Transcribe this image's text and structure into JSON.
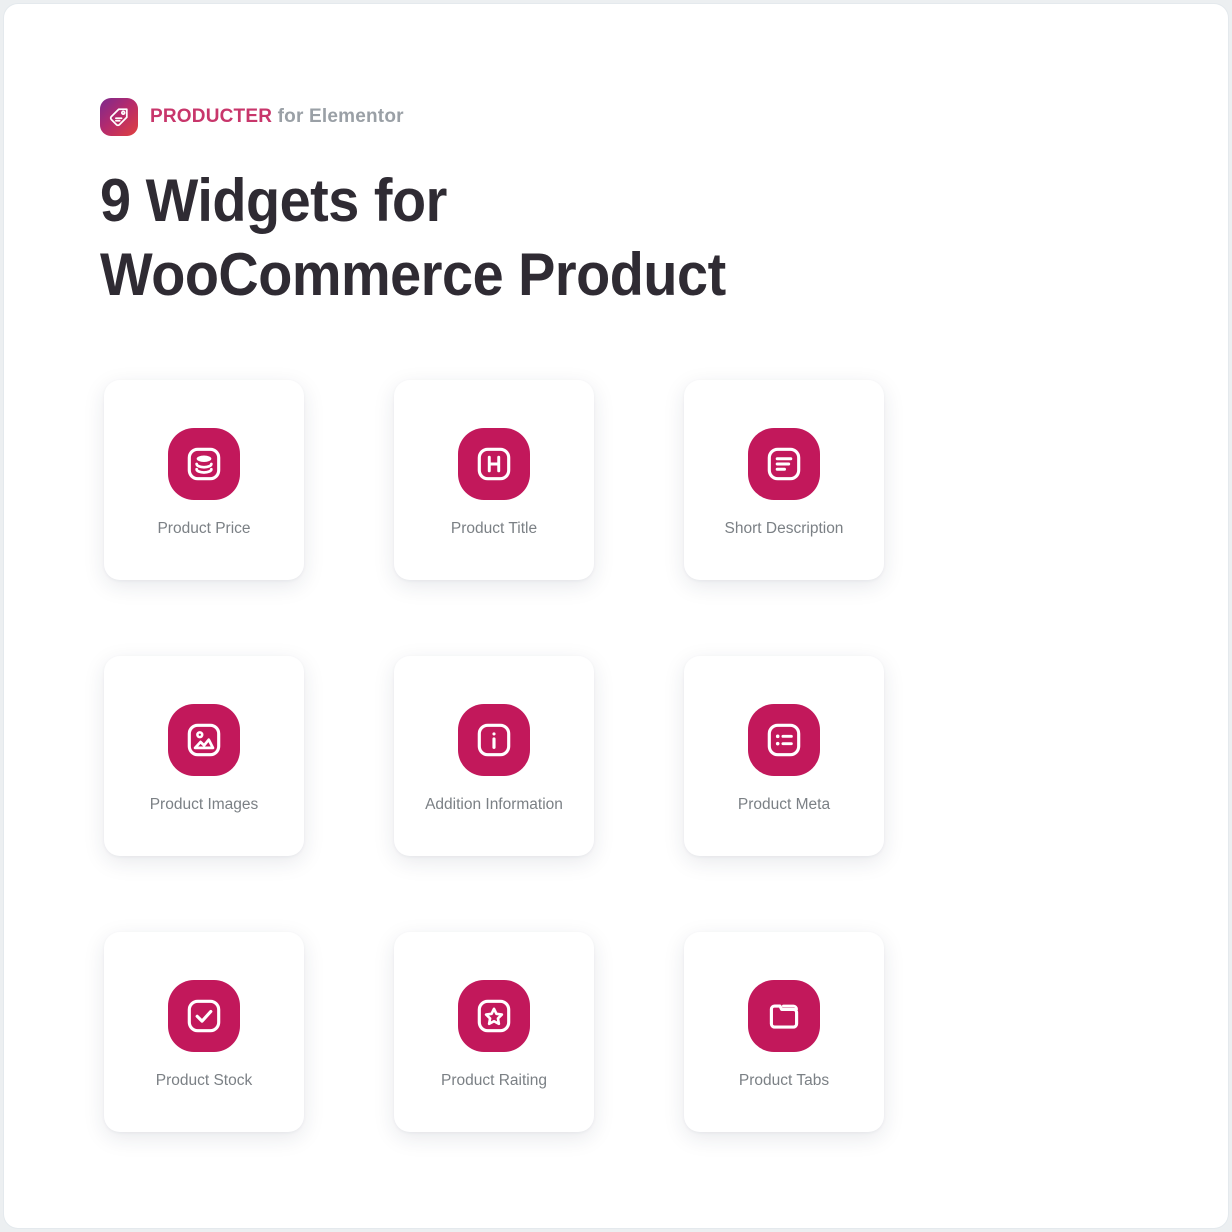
{
  "brand": {
    "logo_icon": "price-tag-icon",
    "name": "PRODUCTER",
    "suffix": " for Elementor",
    "name_color": "#c8366b",
    "suffix_color": "#9aa0a6"
  },
  "headline": {
    "line1": "9 Widgets for",
    "line2": "WooCommerce Product",
    "color": "#2f2b33"
  },
  "theme": {
    "icon_background": "#c2185b",
    "card_background": "#ffffff",
    "page_background": "#ffffff",
    "label_color": "#7b8085"
  },
  "widgets": [
    {
      "label": "Product Price",
      "icon": "coins-stack-icon"
    },
    {
      "label": "Product Title",
      "icon": "letter-h-icon"
    },
    {
      "label": "Short Description",
      "icon": "text-lines-icon"
    },
    {
      "label": "Product Images",
      "icon": "image-photo-icon"
    },
    {
      "label": "Addition Information",
      "icon": "info-circle-icon"
    },
    {
      "label": "Product Meta",
      "icon": "bulleted-list-icon"
    },
    {
      "label": "Product Stock",
      "icon": "checkmark-box-icon"
    },
    {
      "label": "Product Raiting",
      "icon": "star-box-icon"
    },
    {
      "label": "Product Tabs",
      "icon": "folder-tab-icon"
    }
  ]
}
